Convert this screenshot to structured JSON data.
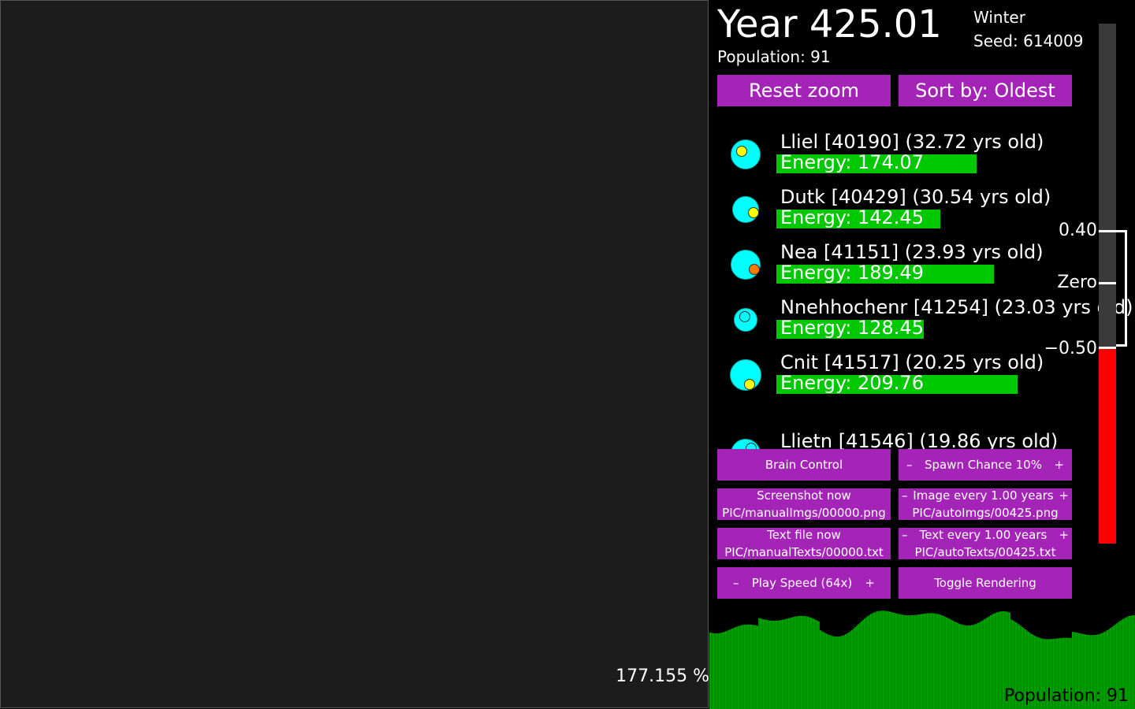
{
  "world": {
    "background": "#1c1c1c",
    "zoom_readout": "177.155 %"
  },
  "header": {
    "year": "Year 425.01",
    "population": "Population: 91",
    "season": "Winter",
    "seed": "Seed: 614009"
  },
  "buttons": {
    "reset_zoom": "Reset zoom",
    "sort_by": "Sort by: Oldest",
    "brain_control": "Brain Control",
    "spawn_minus": "–",
    "spawn_label": "Spawn Chance 10%",
    "spawn_plus": "+",
    "screenshot_label": "Screenshot now",
    "screenshot_path": "PIC/manualImgs/00000.png",
    "image_minus": "–",
    "image_label": "Image every 1.00 years",
    "image_plus": "+",
    "image_path": "PIC/autoImgs/00425.png",
    "textfile_label": "Text file now",
    "textfile_path": "PIC/manualTexts/00000.txt",
    "text_minus": "–",
    "text_label": "Text every 1.00 years",
    "text_plus": "+",
    "text_path": "PIC/autoTexts/00425.txt",
    "speed_minus": "–",
    "speed_label": "Play Speed (64x)",
    "speed_plus": "+",
    "toggle_rendering": "Toggle Rendering",
    "color": "#a424b8"
  },
  "creatures": [
    {
      "name": "Lliel [40190] (32.72 yrs old)",
      "energy": "Energy: 174.07",
      "energy_value": 174.07,
      "mouth_color": "#ffff00"
    },
    {
      "name": "Dutk [40429] (30.54 yrs old)",
      "energy": "Energy: 142.45",
      "energy_value": 142.45,
      "mouth_color": "#ffff00"
    },
    {
      "name": "Nea [41151] (23.93 yrs old)",
      "energy": "Energy: 189.49",
      "energy_value": 189.49,
      "mouth_color": "#ff7a00"
    },
    {
      "name": "Nnehhochenr [41254] (23.03 yrs old)",
      "energy": "Energy: 128.45",
      "energy_value": 128.45,
      "mouth_color": "#00ffff"
    },
    {
      "name": "Cnit [41517] (20.25 yrs old)",
      "energy": "Energy: 209.76",
      "energy_value": 209.76,
      "mouth_color": "#ffff00"
    },
    {
      "name": "Llietn [41546] (19.86 yrs old)",
      "energy": "",
      "energy_value": 0,
      "mouth_color": "#00ffff"
    }
  ],
  "meter": {
    "label_high": "0.40",
    "label_zero": "Zero",
    "label_low": "−0.50",
    "fill_fraction": 0.375,
    "fill_color": "#ff0000"
  },
  "population_graph": {
    "label": "Population: 91",
    "color": "#00a000"
  }
}
